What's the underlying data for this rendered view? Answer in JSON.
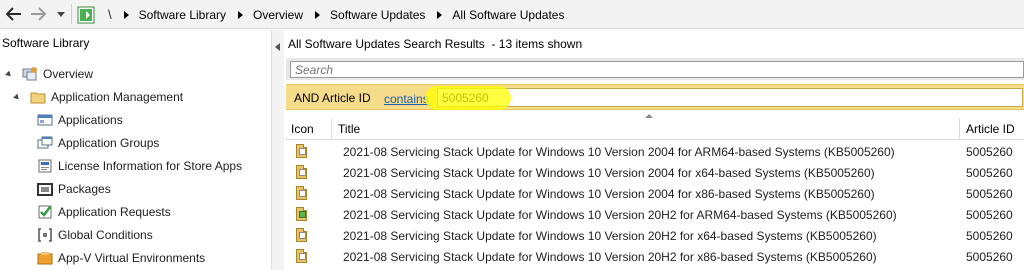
{
  "address_bar": {
    "root": "\\",
    "crumbs": [
      "Software Library",
      "Overview",
      "Software Updates",
      "All Software Updates"
    ]
  },
  "left_pane": {
    "title": "Software Library",
    "tree": [
      {
        "label": "Overview",
        "icon": "overview-icon",
        "level": 0,
        "expanded": true
      },
      {
        "label": "Application Management",
        "icon": "folder-icon",
        "level": 1,
        "expanded": true
      },
      {
        "label": "Applications",
        "icon": "applications-icon",
        "level": 2
      },
      {
        "label": "Application Groups",
        "icon": "application-groups-icon",
        "level": 2
      },
      {
        "label": "License Information for Store Apps",
        "icon": "license-icon",
        "level": 2
      },
      {
        "label": "Packages",
        "icon": "packages-icon",
        "level": 2
      },
      {
        "label": "Application Requests",
        "icon": "application-requests-icon",
        "level": 2
      },
      {
        "label": "Global Conditions",
        "icon": "global-conditions-icon",
        "level": 2
      },
      {
        "label": "App-V Virtual Environments",
        "icon": "appv-icon",
        "level": 2
      }
    ]
  },
  "results": {
    "title": "All Software Updates Search Results",
    "count_text": "-  13 items shown"
  },
  "search": {
    "placeholder": "Search"
  },
  "criteria": {
    "field": "AND Article ID",
    "operator": "contains",
    "value": "5005260"
  },
  "columns": {
    "icon": "Icon",
    "title": "Title",
    "article_id": "Article ID"
  },
  "rows": [
    {
      "title": "2021-08 Servicing Stack Update for Windows 10 Version 2004 for ARM64-based Systems (KB5005260)",
      "article_id": "5005260",
      "icon": "update-icon"
    },
    {
      "title": "2021-08 Servicing Stack Update for Windows 10 Version 2004 for x64-based Systems (KB5005260)",
      "article_id": "5005260",
      "icon": "update-icon"
    },
    {
      "title": "2021-08 Servicing Stack Update for Windows 10 Version 2004 for x86-based Systems (KB5005260)",
      "article_id": "5005260",
      "icon": "update-icon"
    },
    {
      "title": "2021-08 Servicing Stack Update for Windows 10 Version 20H2 for ARM64-based Systems (KB5005260)",
      "article_id": "5005260",
      "icon": "update-deployed-icon"
    },
    {
      "title": "2021-08 Servicing Stack Update for Windows 10 Version 20H2 for x64-based Systems (KB5005260)",
      "article_id": "5005260",
      "icon": "update-icon"
    },
    {
      "title": "2021-08 Servicing Stack Update for Windows 10 Version 20H2 for x86-based Systems (KB5005260)",
      "article_id": "5005260",
      "icon": "update-icon"
    }
  ],
  "colors": {
    "criteria_bar": "#f5dc8b",
    "highlight": "#ffff00",
    "link": "#1a5fb4"
  }
}
